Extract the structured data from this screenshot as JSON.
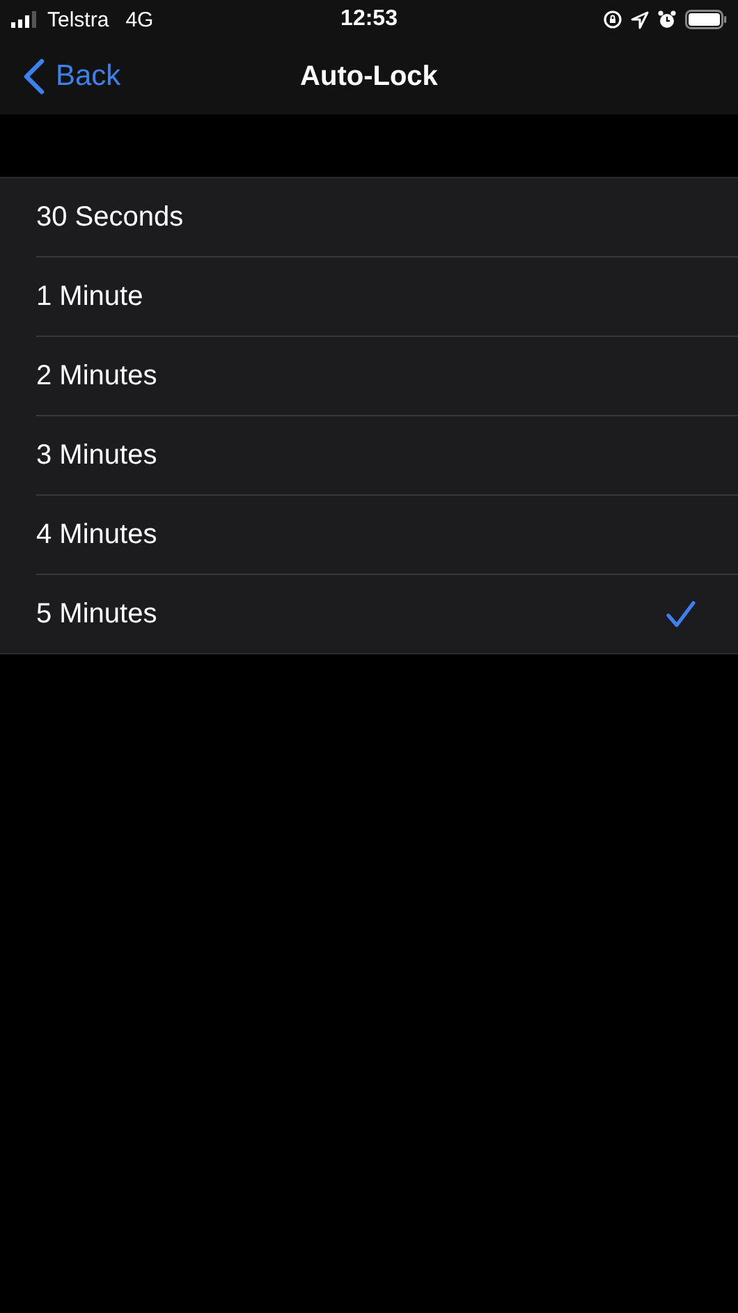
{
  "status_bar": {
    "carrier": "Telstra",
    "network": "4G",
    "time": "12:53"
  },
  "nav": {
    "back": "Back",
    "title": "Auto-Lock"
  },
  "options": [
    {
      "label": "30 Seconds",
      "selected": false
    },
    {
      "label": "1 Minute",
      "selected": false
    },
    {
      "label": "2 Minutes",
      "selected": false
    },
    {
      "label": "3 Minutes",
      "selected": false
    },
    {
      "label": "4 Minutes",
      "selected": false
    },
    {
      "label": "5 Minutes",
      "selected": true
    }
  ]
}
